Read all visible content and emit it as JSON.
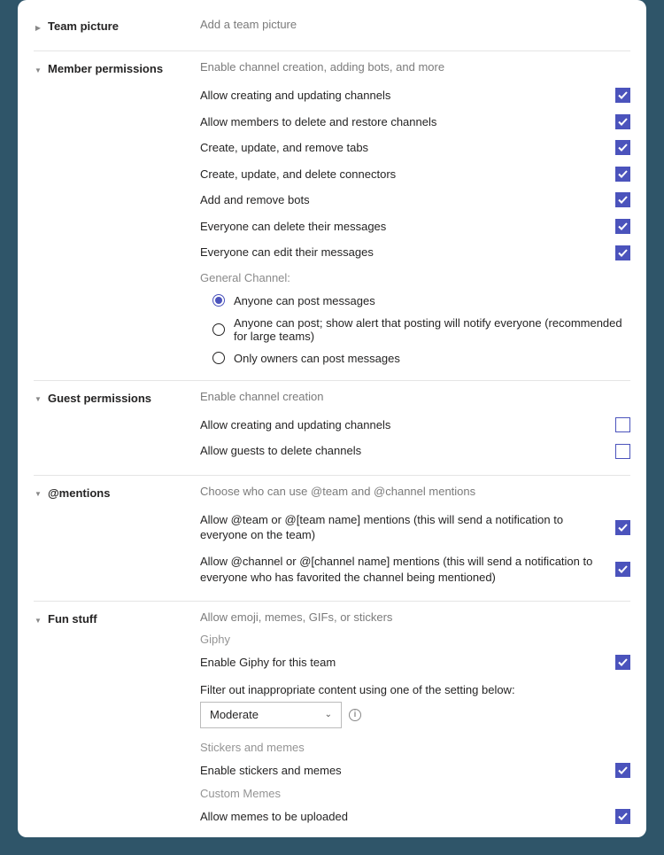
{
  "sections": {
    "teamPicture": {
      "title": "Team picture",
      "desc": "Add a team picture"
    },
    "memberPermissions": {
      "title": "Member permissions",
      "desc": "Enable channel creation, adding bots, and more",
      "items": [
        {
          "label": "Allow creating and updating channels",
          "checked": true
        },
        {
          "label": "Allow members to delete and restore channels",
          "checked": true
        },
        {
          "label": "Create, update, and remove tabs",
          "checked": true
        },
        {
          "label": "Create, update, and delete connectors",
          "checked": true
        },
        {
          "label": "Add and remove bots",
          "checked": true
        },
        {
          "label": "Everyone can delete their messages",
          "checked": true
        },
        {
          "label": "Everyone can edit their messages",
          "checked": true
        }
      ],
      "generalChannelLabel": "General Channel:",
      "radios": [
        {
          "label": "Anyone can post messages",
          "selected": true
        },
        {
          "label": "Anyone can post; show alert that posting will notify everyone (recommended for large teams)",
          "selected": false
        },
        {
          "label": "Only owners can post messages",
          "selected": false
        }
      ]
    },
    "guestPermissions": {
      "title": "Guest permissions",
      "desc": "Enable channel creation",
      "items": [
        {
          "label": "Allow creating and updating channels",
          "checked": false
        },
        {
          "label": "Allow guests to delete channels",
          "checked": false
        }
      ]
    },
    "mentions": {
      "title": "@mentions",
      "desc": "Choose who can use @team and @channel mentions",
      "items": [
        {
          "label": "Allow @team or @[team name] mentions (this will send a notification to everyone on the team)",
          "checked": true
        },
        {
          "label": "Allow @channel or @[channel name] mentions (this will send a notification to everyone who has favorited the channel being mentioned)",
          "checked": true
        }
      ]
    },
    "funStuff": {
      "title": "Fun stuff",
      "desc": "Allow emoji, memes, GIFs, or stickers",
      "giphyLabel": "Giphy",
      "giphyEnable": {
        "label": "Enable Giphy for this team",
        "checked": true
      },
      "filterLabel": "Filter out inappropriate content using one of the setting below:",
      "filterSelected": "Moderate",
      "stickersLabel": "Stickers and memes",
      "stickersEnable": {
        "label": "Enable stickers and memes",
        "checked": true
      },
      "customMemesLabel": "Custom Memes",
      "customMemesEnable": {
        "label": "Allow memes to be uploaded",
        "checked": true
      }
    }
  }
}
